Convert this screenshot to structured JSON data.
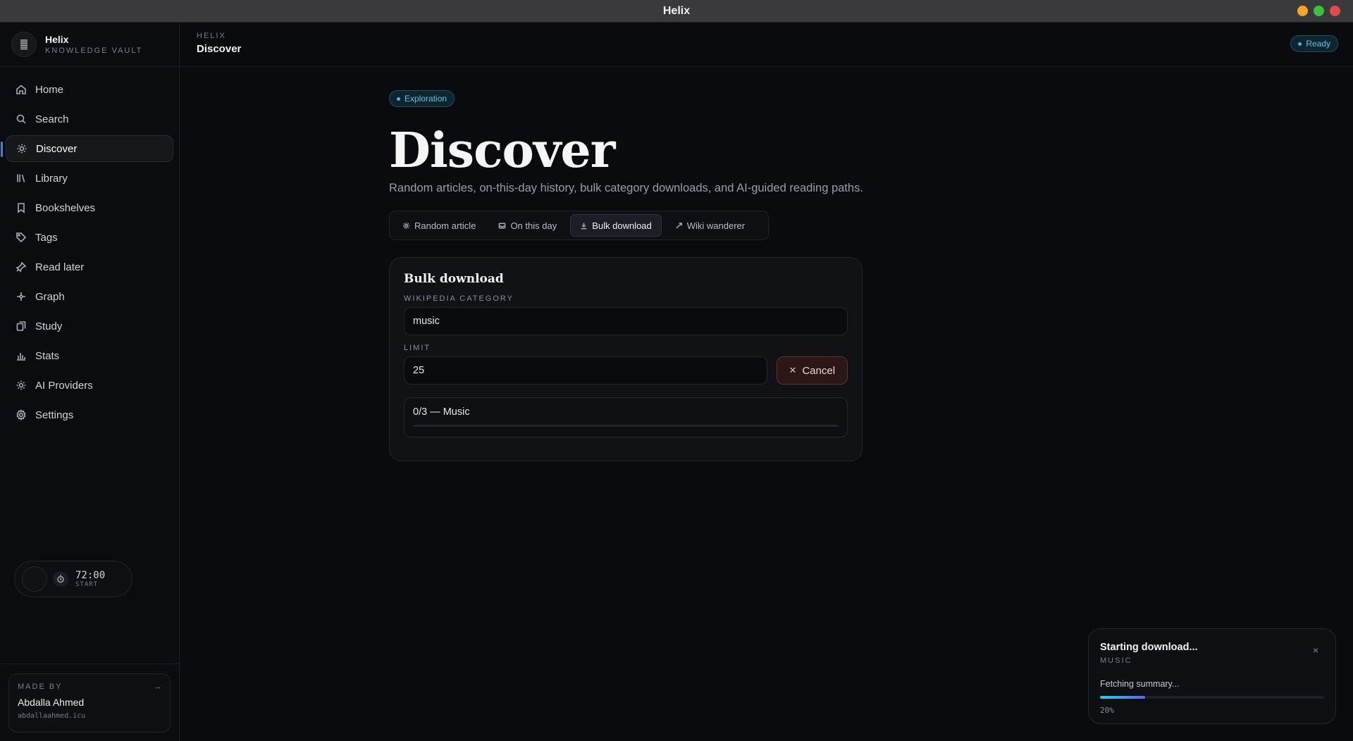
{
  "window": {
    "title": "Helix"
  },
  "colors": {
    "accent": "#3b82f6",
    "info": "#5cc6e8",
    "danger_bg": "#2a1716",
    "traffic_yellow": "#f5a623",
    "traffic_green": "#3fbf3f",
    "traffic_red": "#e5484d"
  },
  "brand": {
    "name": "Helix",
    "subtitle": "KNOWLEDGE VAULT",
    "icon": "layers-icon"
  },
  "sidebar": {
    "items": [
      {
        "label": "Home",
        "icon": "home-icon",
        "active": false
      },
      {
        "label": "Search",
        "icon": "search-icon",
        "active": false
      },
      {
        "label": "Discover",
        "icon": "sparkle-icon",
        "active": true
      },
      {
        "label": "Library",
        "icon": "library-icon",
        "active": false
      },
      {
        "label": "Bookshelves",
        "icon": "bookmark-icon",
        "active": false
      },
      {
        "label": "Tags",
        "icon": "tag-icon",
        "active": false
      },
      {
        "label": "Read later",
        "icon": "pin-icon",
        "active": false
      },
      {
        "label": "Graph",
        "icon": "graph-icon",
        "active": false
      },
      {
        "label": "Study",
        "icon": "cards-icon",
        "active": false
      },
      {
        "label": "Stats",
        "icon": "bar-chart-icon",
        "active": false
      },
      {
        "label": "AI Providers",
        "icon": "ai-icon",
        "active": false
      },
      {
        "label": "Settings",
        "icon": "gear-icon",
        "active": false
      }
    ]
  },
  "timer": {
    "time": "72:00",
    "label": "START"
  },
  "footer": {
    "label": "MADE BY",
    "name": "Abdalla Ahmed",
    "site": "abdallaahmed.icu",
    "arrow": "→"
  },
  "header": {
    "crumb": "HELIX",
    "title": "Discover",
    "status": "Ready"
  },
  "page": {
    "pill": "Exploration",
    "title": "Discover",
    "subtitle": "Random articles, on-this-day history, bulk category downloads, and AI-guided reading paths.",
    "tabs": [
      {
        "label": "Random article",
        "icon": "sparkle-icon",
        "active": false
      },
      {
        "label": "On this day",
        "icon": "inbox-icon",
        "active": false
      },
      {
        "label": "Bulk download",
        "icon": "download-icon",
        "active": true
      },
      {
        "label": "Wiki wanderer",
        "icon": "wander-icon",
        "active": false
      }
    ]
  },
  "bulk": {
    "title": "Bulk download",
    "category_label": "WIKIPEDIA CATEGORY",
    "category_value": "music",
    "limit_label": "LIMIT",
    "limit_value": "25",
    "cancel_label": "Cancel",
    "progress_text": "0/3 — Music",
    "progress_fraction": 0
  },
  "toast": {
    "title": "Starting download...",
    "subtitle": "MUSIC",
    "message": "Fetching summary...",
    "percent_text": "20%",
    "progress": 0.2,
    "close": "×"
  }
}
